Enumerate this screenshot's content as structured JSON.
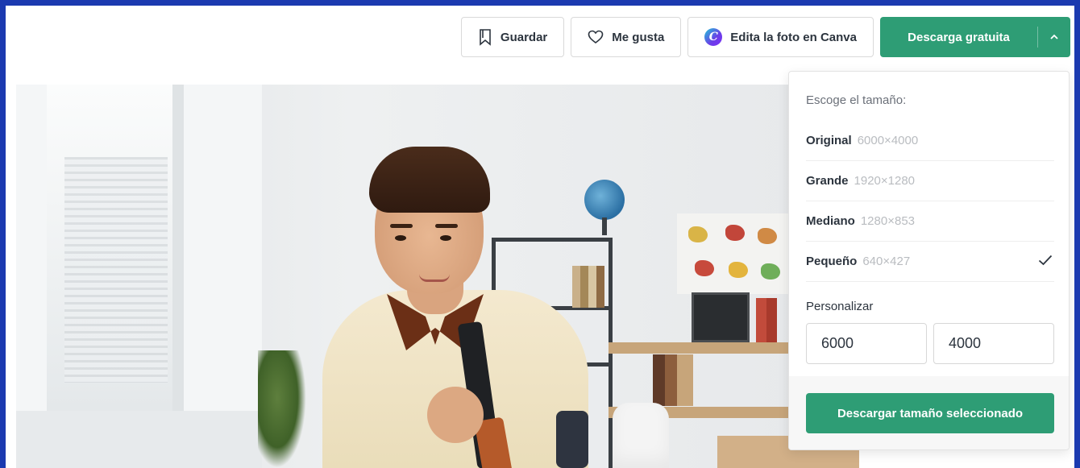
{
  "toolbar": {
    "save_label": "Guardar",
    "like_label": "Me gusta",
    "canva_label": "Edita la foto en Canva",
    "download_label": "Descarga gratuita"
  },
  "dropdown": {
    "heading": "Escoge el tamaño:",
    "sizes": [
      {
        "name": "Original",
        "dims": "6000×4000",
        "selected": false
      },
      {
        "name": "Grande",
        "dims": "1920×1280",
        "selected": false
      },
      {
        "name": "Mediano",
        "dims": "1280×853",
        "selected": false
      },
      {
        "name": "Pequeño",
        "dims": "640×427",
        "selected": true
      }
    ],
    "custom_label": "Personalizar",
    "custom_width": "6000",
    "custom_height": "4000",
    "submit_label": "Descargar tamaño seleccionado"
  },
  "colors": {
    "accent": "#2e9d75",
    "frame": "#1b3ab0"
  },
  "icons": {
    "save": "bookmark-icon",
    "like": "heart-icon",
    "canva": "canva-logo-icon",
    "caret": "chevron-up-icon",
    "check": "check-icon"
  }
}
